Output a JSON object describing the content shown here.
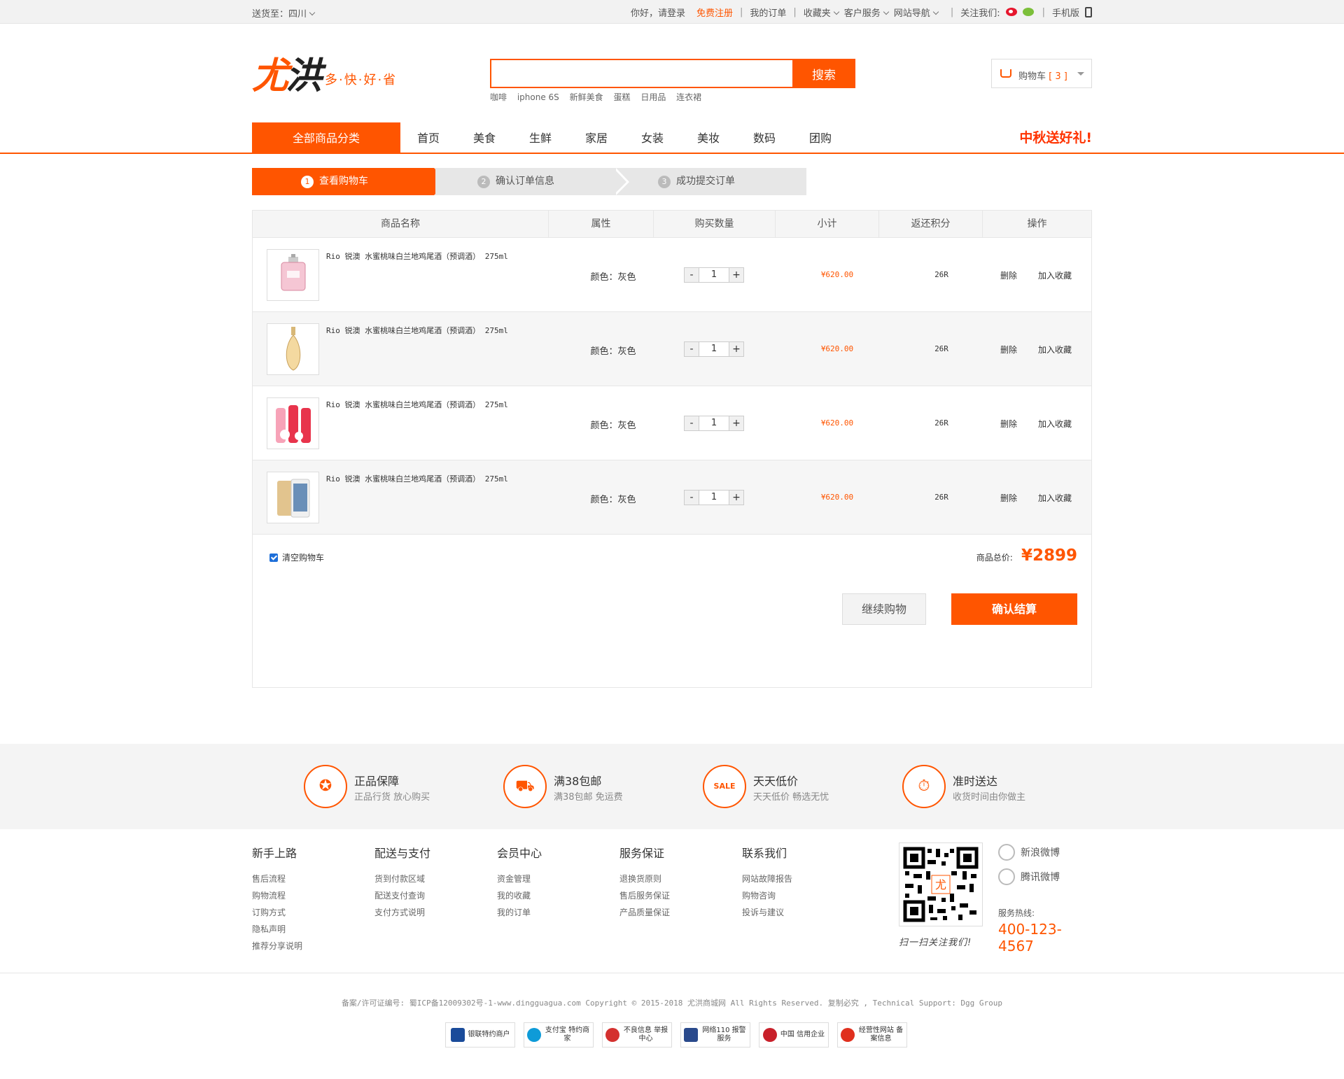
{
  "topbar": {
    "ship_to_label": "送货至：",
    "ship_to_value": "四川",
    "greeting": "你好，请登录",
    "register": "免费注册",
    "my_orders": "我的订单",
    "favorites": "收藏夹",
    "customer_service": "客户服务",
    "site_nav": "网站导航",
    "follow_us": "关注我们:",
    "mobile": "手机版"
  },
  "header": {
    "logo_char1": "尤",
    "logo_char2": "洪",
    "slogan": "多·快·好·省",
    "search_placeholder": "",
    "search_button": "搜索",
    "hot_words": [
      "咖啡",
      "iphone 6S",
      "新鲜美食",
      "蛋糕",
      "日用品",
      "连衣裙"
    ],
    "cart_label": "购物车",
    "cart_count": "[ 3 ]"
  },
  "nav": {
    "all_categories": "全部商品分类",
    "items": [
      "首页",
      "美食",
      "生鲜",
      "家居",
      "女装",
      "美妆",
      "数码",
      "团购"
    ],
    "promo": "中秋送好礼!"
  },
  "steps": [
    {
      "num": "1",
      "label": "查看购物车"
    },
    {
      "num": "2",
      "label": "确认订单信息"
    },
    {
      "num": "3",
      "label": "成功提交订单"
    }
  ],
  "cart_table": {
    "headers": [
      "商品名称",
      "属性",
      "购买数量",
      "小计",
      "返还积分",
      "操作"
    ],
    "rows": [
      {
        "name": "Rio 锐澳 水蜜桃味白兰地鸡尾酒（预调酒） 275ml",
        "attr": "颜色：灰色",
        "qty": "1",
        "subtotal": "¥620.00",
        "points": "26R",
        "delete": "删除",
        "favorite": "加入收藏"
      },
      {
        "name": "Rio 锐澳 水蜜桃味白兰地鸡尾酒（预调酒） 275ml",
        "attr": "颜色：灰色",
        "qty": "1",
        "subtotal": "¥620.00",
        "points": "26R",
        "delete": "删除",
        "favorite": "加入收藏"
      },
      {
        "name": "Rio 锐澳 水蜜桃味白兰地鸡尾酒（预调酒） 275ml",
        "attr": "颜色：灰色",
        "qty": "1",
        "subtotal": "¥620.00",
        "points": "26R",
        "delete": "删除",
        "favorite": "加入收藏"
      },
      {
        "name": "Rio 锐澳 水蜜桃味白兰地鸡尾酒（预调酒） 275ml",
        "attr": "颜色：灰色",
        "qty": "1",
        "subtotal": "¥620.00",
        "points": "26R",
        "delete": "删除",
        "favorite": "加入收藏"
      }
    ],
    "minus": "-",
    "plus": "+",
    "clear_cart": "清空购物车",
    "total_label": "商品总价:",
    "total_value": "¥2899",
    "continue_button": "继续购物",
    "checkout_button": "确认结算"
  },
  "services": [
    {
      "title": "正品保障",
      "desc": "正品行货 放心购买",
      "icon": "medal-icon"
    },
    {
      "title": "满38包邮",
      "desc": "满38包邮 免运费",
      "icon": "truck-icon"
    },
    {
      "title": "天天低价",
      "desc": "天天低价 畅选无忧",
      "icon": "sale-tag-icon"
    },
    {
      "title": "准时送达",
      "desc": "收货时间由你做主",
      "icon": "stopwatch-icon"
    }
  ],
  "footer_links": [
    {
      "title": "新手上路",
      "items": [
        "售后流程",
        "购物流程",
        "订购方式",
        "隐私声明",
        "推荐分享说明"
      ]
    },
    {
      "title": "配送与支付",
      "items": [
        "货到付款区域",
        "配送支付查询",
        "支付方式说明"
      ]
    },
    {
      "title": "会员中心",
      "items": [
        "资金管理",
        "我的收藏",
        "我的订单"
      ]
    },
    {
      "title": "服务保证",
      "items": [
        "退换货原则",
        "售后服务保证",
        "产品质量保证"
      ]
    },
    {
      "title": "联系我们",
      "items": [
        "网站故障报告",
        "购物咨询",
        "投诉与建议"
      ]
    }
  ],
  "qr": {
    "center": "尤",
    "caption": "扫一扫关注我们!"
  },
  "social": {
    "weibo": "新浪微博",
    "tencent": "腾讯微博",
    "hotline_label": "服务热线:",
    "hotline": "400-123-4567"
  },
  "copyright": "备案/许可证编号: 蜀ICP备12009302号-1-www.dingguagua.com Copyright © 2015-2018 尤洪商城网 All Rights Reserved. 复制必究 , Technical Support: Dgg Group",
  "badges": [
    "银联特约商户",
    "支付宝 特约商家",
    "不良信息 举报中心",
    "网络110 报警服务",
    "中国 信用企业",
    "经营性网站 备案信息"
  ],
  "colors": {
    "accent": "#ff5500",
    "promo": "#ff3300"
  }
}
